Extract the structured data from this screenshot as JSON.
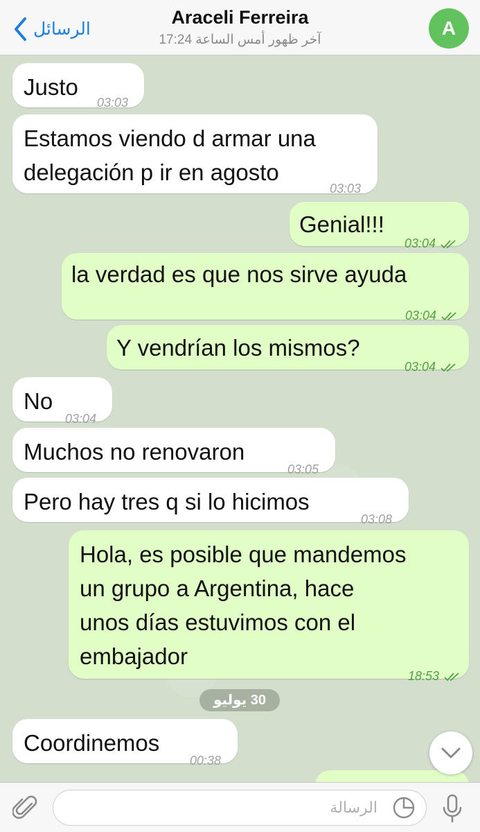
{
  "header": {
    "back_label": "الرسائل",
    "title": "Araceli Ferreira",
    "subtitle": "آخر ظهور أمس الساعة 17:24",
    "avatar_letter": "A",
    "avatar_color": "#61c25e"
  },
  "messages": [
    {
      "direction": "in",
      "lines": [
        "Justo"
      ],
      "time": "03:03"
    },
    {
      "direction": "in",
      "lines": [
        "Estamos viendo d armar una",
        "delegación p ir en agosto"
      ],
      "time": "03:03"
    },
    {
      "direction": "out",
      "lines": [
        "Genial!!!"
      ],
      "time": "03:04",
      "status": "read"
    },
    {
      "direction": "out",
      "lines": [
        "la verdad es que nos sirve ayuda"
      ],
      "time": "03:04",
      "status": "read"
    },
    {
      "direction": "out",
      "lines": [
        "Y vendrían los mismos?"
      ],
      "time": "03:04",
      "status": "read"
    },
    {
      "direction": "in",
      "lines": [
        "No"
      ],
      "time": "03:04"
    },
    {
      "direction": "in",
      "lines": [
        "Muchos no renovaron"
      ],
      "time": "03:05"
    },
    {
      "direction": "in",
      "lines": [
        "Pero hay tres q si lo hicimos"
      ],
      "time": "03:08"
    },
    {
      "direction": "out",
      "lines": [
        "Hola, es posible que mandemos",
        "un grupo  a Argentina, hace",
        "unos días estuvimos con el",
        "embajador"
      ],
      "time": "18:53",
      "status": "read"
    },
    {
      "direction": "in",
      "lines": [
        "Coordinemos"
      ],
      "time": "00:38"
    }
  ],
  "date_separator": "30 يوليو",
  "input": {
    "placeholder": "الرسالة"
  },
  "colors": {
    "incoming_bubble": "#ffffff",
    "outgoing_bubble": "#e1fec6",
    "accent": "#1a7fe0",
    "read_ticks": "#53a046"
  },
  "icons": {
    "back": "chevron-left-icon",
    "attach": "paperclip-icon",
    "sticker": "sticker-icon",
    "mic": "microphone-icon",
    "scroll": "chevron-down-icon"
  }
}
